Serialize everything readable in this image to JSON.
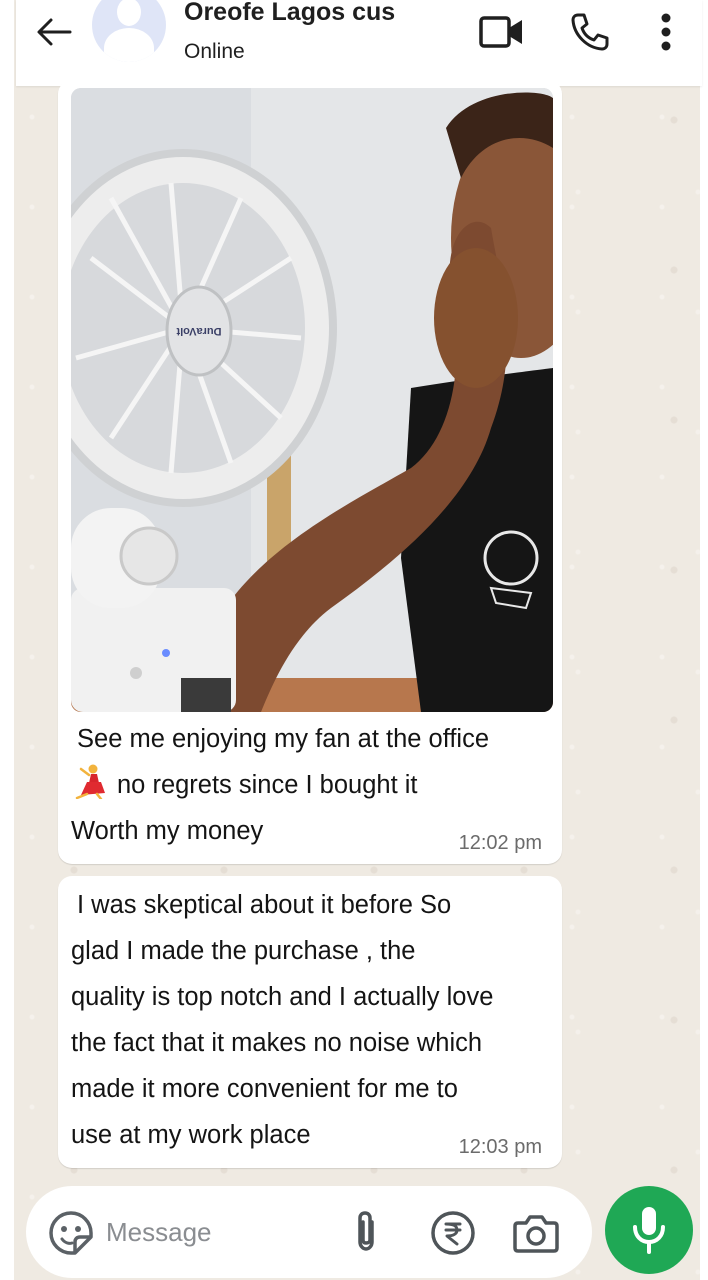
{
  "header": {
    "contact_name": "Oreofe Lagos cus",
    "status": "Online",
    "icons": [
      "back-arrow-icon",
      "video-call-icon",
      "phone-icon",
      "more-vert-icon"
    ]
  },
  "messages": [
    {
      "type": "image",
      "image_alt": "Photo of a person resting beside a white DuraVolt desk fan at the office",
      "fan_brand_text": "DuraVolt",
      "lines": [
        "See me enjoying my fan at the office",
        "no regrets since I bought it",
        "Worth my money"
      ],
      "emoji": "dancer",
      "time": "12:02 pm"
    },
    {
      "type": "text",
      "lines": [
        "I was skeptical about it before So",
        "glad I made the purchase , the",
        "quality is top notch and I actually love",
        "the fact that it makes no noise which",
        "made it more convenient for me to",
        "use at my work place"
      ],
      "time": "12:03 pm"
    }
  ],
  "input": {
    "placeholder": "Message",
    "value": ""
  },
  "colors": {
    "chat_background": "#efeae2",
    "bubble": "#ffffff",
    "accent_green": "#1fa855",
    "icon_dark": "#1f2c33"
  }
}
